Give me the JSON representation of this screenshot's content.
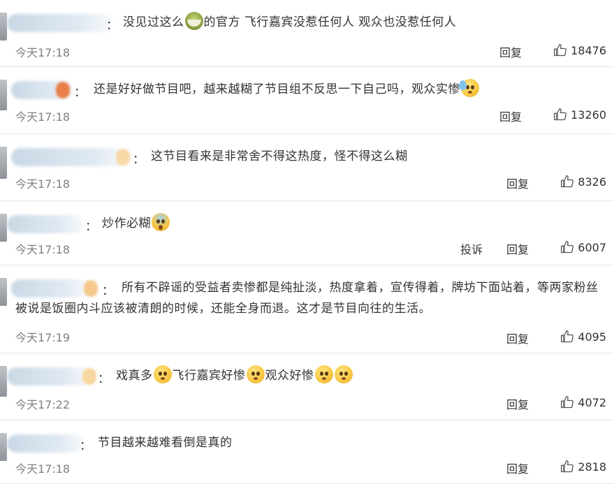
{
  "comments": [
    {
      "text_lines": [
        [
          "没见过这么",
          {
            "emoji": "tea-emoji"
          },
          "的官方 飞行嘉宾没惹任何人 观众也没惹任何人"
        ]
      ],
      "time": "今天17:18",
      "actions": [
        "回复"
      ],
      "likes": "18476"
    },
    {
      "text_lines": [
        [
          "还是好好做节目吧，越来越糊了节目组不反思一下自己吗，观众实惨",
          {
            "emoji": "sweat-emoji"
          }
        ]
      ],
      "time": "今天17:18",
      "actions": [
        "回复"
      ],
      "likes": "13260"
    },
    {
      "text_lines": [
        [
          "这节目看来是非常舍不得这热度，怪不得这么糊"
        ]
      ],
      "time": "今天17:18",
      "actions": [
        "回复"
      ],
      "likes": "8326"
    },
    {
      "text_lines": [
        [
          "炒作必糊",
          {
            "emoji": "scream-emoji"
          }
        ]
      ],
      "time": "今天17:18",
      "actions": [
        "投诉",
        "回复"
      ],
      "likes": "6007"
    },
    {
      "text_lines": [
        [
          "所有不辟谣的受益者卖惨都是纯扯淡，热度拿着，宣传得着，牌坊下面站着，等两家粉丝"
        ],
        [
          "被说是饭圈内斗应该被清朗的时候，还能全身而退。这才是节目向往的生活。"
        ]
      ],
      "time": "今天17:19",
      "actions": [
        "回复"
      ],
      "likes": "4095"
    },
    {
      "text_lines": [
        [
          "戏真多",
          {
            "emoji": "pleading-emoji"
          },
          "飞行嘉宾好惨",
          {
            "emoji": "pleading-emoji"
          },
          "观众好惨",
          {
            "emoji": "pleading-emoji"
          },
          {
            "emoji": "pleading-emoji"
          }
        ]
      ],
      "time": "今天17:22",
      "actions": [
        "回复"
      ],
      "likes": "4072"
    },
    {
      "text_lines": [
        [
          "节目越来越难看倒是真的"
        ]
      ],
      "time": "今天17:18",
      "actions": [
        "回复"
      ],
      "likes": "2818"
    }
  ],
  "colon": "：",
  "icons": {
    "like": "thumbs-up-icon"
  },
  "colors": {
    "text": "#333333",
    "time": "#808080",
    "divider": "#e6e6e6"
  }
}
